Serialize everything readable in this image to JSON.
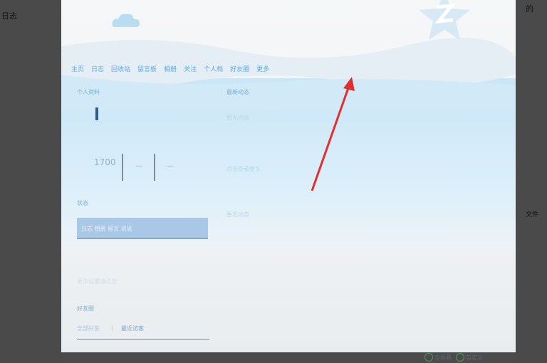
{
  "background": {
    "left_text": "日志",
    "right_text_1": "的",
    "right_text_2": "文件"
  },
  "nav": {
    "items": [
      "主页",
      "日志",
      "回收站",
      "留言板",
      "相册",
      "关注",
      "个人档",
      "好友圈",
      "更多"
    ]
  },
  "left_panel": {
    "personal_label": "个人资料",
    "number": "1700",
    "dash1": "—",
    "dash2": "—",
    "section_label": "状态",
    "select_value": "日志 相册 留言 说说",
    "faint_link": "更多设置请点击",
    "friends_label": "好友圈",
    "tab1": "全部好友",
    "tab_sep": "|",
    "tab2": "最近访客"
  },
  "right_panel": {
    "recent_label": "最新动态",
    "faint1": "暂无内容",
    "faint2": "点击查看更多",
    "faint3": "暂无动态"
  },
  "footer": {
    "item1": "全屏幕",
    "item2": "自定义"
  },
  "colors": {
    "accent": "#5fa8d6",
    "arrow": "#e0302e"
  }
}
